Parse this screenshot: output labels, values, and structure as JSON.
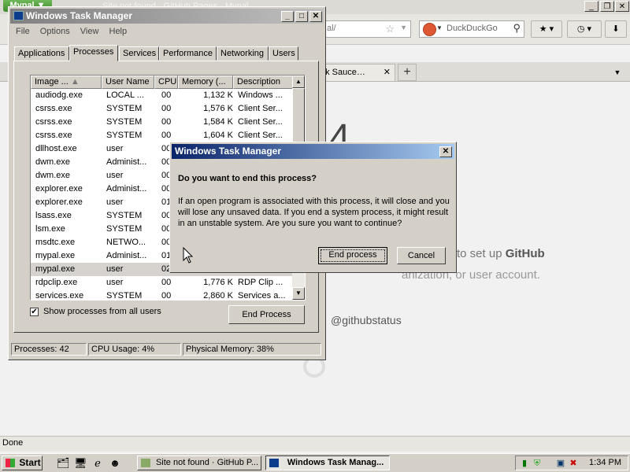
{
  "browser": {
    "menu_button": "Mypal ▼",
    "window_title": "Site not found · GitHub Pages - Mypal",
    "url_text": "al/",
    "search_placeholder": "DuckDuckGo",
    "tab_label": "nk Sauce…",
    "page_digit": "4",
    "page_text_1_prefix": "to set up ",
    "page_text_1_bold": "GitHub",
    "page_text_2": "anization, or user account.",
    "page_status": "@githubstatus",
    "status_text": "Done"
  },
  "taskmgr": {
    "title": "Windows Task Manager",
    "menu": [
      "File",
      "Options",
      "View",
      "Help"
    ],
    "tabs": [
      "Applications",
      "Processes",
      "Services",
      "Performance",
      "Networking",
      "Users"
    ],
    "selected_tab": "Processes",
    "columns": [
      "Image ...",
      "User Name",
      "CPU",
      "Memory (...",
      "Description"
    ],
    "rows": [
      {
        "image": "audiodg.exe",
        "user": "LOCAL ...",
        "cpu": "00",
        "mem": "1,132 K",
        "desc": "Windows ..."
      },
      {
        "image": "csrss.exe",
        "user": "SYSTEM",
        "cpu": "00",
        "mem": "1,576 K",
        "desc": "Client Ser..."
      },
      {
        "image": "csrss.exe",
        "user": "SYSTEM",
        "cpu": "00",
        "mem": "1,584 K",
        "desc": "Client Ser..."
      },
      {
        "image": "csrss.exe",
        "user": "SYSTEM",
        "cpu": "00",
        "mem": "1,604 K",
        "desc": "Client Ser..."
      },
      {
        "image": "dllhost.exe",
        "user": "user",
        "cpu": "00",
        "mem": "",
        "desc": ""
      },
      {
        "image": "dwm.exe",
        "user": "Administ...",
        "cpu": "00",
        "mem": "",
        "desc": ""
      },
      {
        "image": "dwm.exe",
        "user": "user",
        "cpu": "00",
        "mem": "",
        "desc": ""
      },
      {
        "image": "explorer.exe",
        "user": "Administ...",
        "cpu": "00",
        "mem": "",
        "desc": ""
      },
      {
        "image": "explorer.exe",
        "user": "user",
        "cpu": "01",
        "mem": "",
        "desc": ""
      },
      {
        "image": "lsass.exe",
        "user": "SYSTEM",
        "cpu": "00",
        "mem": "",
        "desc": ""
      },
      {
        "image": "lsm.exe",
        "user": "SYSTEM",
        "cpu": "00",
        "mem": "",
        "desc": ""
      },
      {
        "image": "msdtc.exe",
        "user": "NETWO...",
        "cpu": "00",
        "mem": "",
        "desc": ""
      },
      {
        "image": "mypal.exe",
        "user": "Administ...",
        "cpu": "01",
        "mem": "",
        "desc": ""
      },
      {
        "image": "mypal.exe",
        "user": "user",
        "cpu": "02",
        "mem": "",
        "desc": ""
      },
      {
        "image": "rdpclip.exe",
        "user": "user",
        "cpu": "00",
        "mem": "1,776 K",
        "desc": "RDP Clip ..."
      },
      {
        "image": "services.exe",
        "user": "SYSTEM",
        "cpu": "00",
        "mem": "2,860 K",
        "desc": "Services a..."
      }
    ],
    "show_all_label": "Show processes from all users",
    "show_all_checked": "✔",
    "end_process_label": "End Process",
    "status": {
      "processes": "Processes: 42",
      "cpu": "CPU Usage: 4%",
      "memory": "Physical Memory: 38%"
    }
  },
  "dialog": {
    "title": "Windows Task Manager",
    "question": "Do you want to end this process?",
    "message": "If an open program is associated with this process, it will close and you will lose any unsaved data. If you end a system process, it might result in an unstable system. Are you sure you want to continue?",
    "ok_label": "End process",
    "cancel_label": "Cancel"
  },
  "taskbar": {
    "start_label": "Start",
    "tasks": [
      "Site not found · GitHub P...",
      "Windows Task Manag..."
    ],
    "clock": "1:34 PM"
  }
}
